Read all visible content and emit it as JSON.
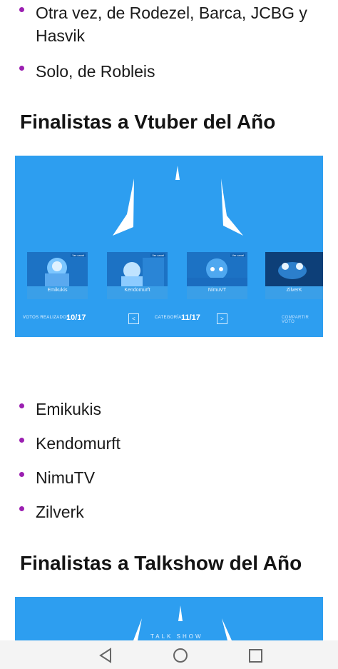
{
  "top_list": [
    {
      "line1": "Otra vez, de Rodezel, Barca, JCBG y",
      "line2": "Hasvik"
    },
    {
      "line1": "Solo, de Robleis",
      "line2": ""
    }
  ],
  "section1": {
    "title": "Finalistas a Vtuber del Año",
    "banner": {
      "cards": [
        {
          "name": "Emikukis",
          "tag": "Ver canal"
        },
        {
          "name": "Kendomurft",
          "tag": "Ver canal"
        },
        {
          "name": "NimuVT",
          "tag": "Ver canal"
        },
        {
          "name": "ZilverK",
          "tag": ""
        }
      ],
      "votes_label": "VOTOS REALIZADOS",
      "votes_value": "10/17",
      "category_label": "CATEGORÍA",
      "category_value": "11/17",
      "prev_label": "<",
      "next_label": ">",
      "share_label": "COMPARTIR VOTO"
    },
    "list": [
      "Emikukis",
      "Kendomurft",
      "NimuTV",
      "Zilverk"
    ]
  },
  "section2": {
    "title": "Finalistas a Talkshow del Año",
    "banner_text": "TALK SHOW"
  },
  "colors": {
    "accent": "#9b1fb1",
    "banner": "#2d9ef0"
  }
}
